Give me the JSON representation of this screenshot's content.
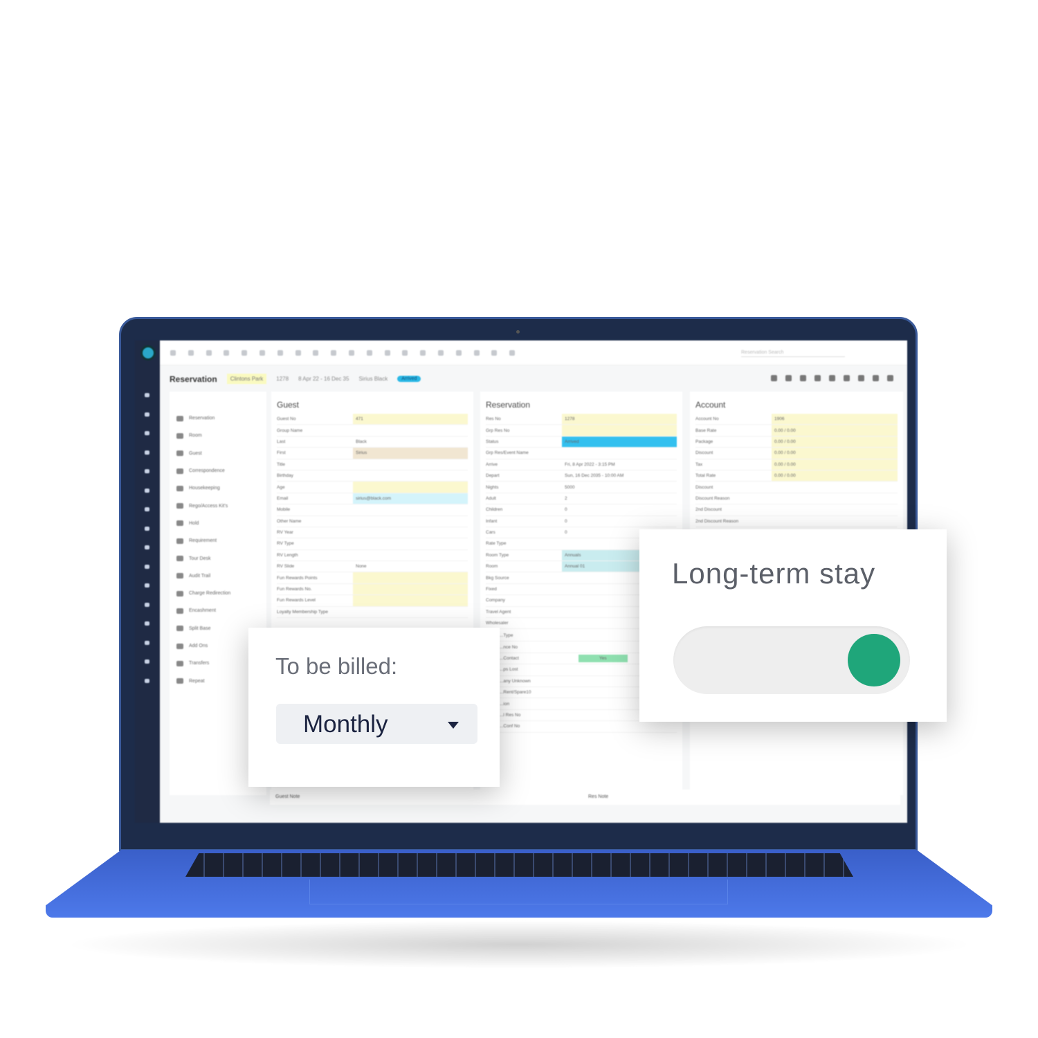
{
  "header": {
    "title": "Reservation",
    "property": "Clintons Park",
    "res_no": "1278",
    "dates": "8 Apr 22 - 16 Dec 35",
    "guest": "Sirius Black",
    "status": "Arrived",
    "search_placeholder": "Reservation Search"
  },
  "menu": [
    "Reservation",
    "Room",
    "Guest",
    "Correspondence",
    "Housekeeping",
    "Rego/Access Kit's",
    "Hold",
    "Requirement",
    "Tour Desk",
    "Audit Trail",
    "Charge Redirection",
    "Encashment",
    "Split Base",
    "Add Ons",
    "Transfers",
    "Repeat"
  ],
  "guest": {
    "title": "Guest",
    "rows": [
      [
        "Guest No",
        "471",
        "#fbf8cf"
      ],
      [
        "Group Name",
        "",
        ""
      ],
      [
        "Last",
        "Black",
        ""
      ],
      [
        "First",
        "Sirius",
        "#f1e6d2"
      ],
      [
        "Title",
        "",
        ""
      ],
      [
        "Birthday",
        "",
        ""
      ],
      [
        "Age",
        "",
        "#fbf8cf"
      ],
      [
        "Email",
        "sirius@black.com",
        "#d4f4fb"
      ],
      [
        "Mobile",
        "",
        ""
      ],
      [
        "Other Name",
        "",
        ""
      ],
      [
        "RV Year",
        "",
        ""
      ],
      [
        "RV Type",
        "",
        ""
      ],
      [
        "RV Length",
        "",
        ""
      ],
      [
        "RV Slide",
        "None",
        ""
      ],
      [
        "Fun Rewards Points",
        "",
        "#fbf8cf"
      ],
      [
        "Fun Rewards No.",
        "",
        "#fbf8cf"
      ],
      [
        "Fun Rewards Level",
        "",
        "#fbf8cf"
      ],
      [
        "Loyalty Membership Type",
        "",
        ""
      ]
    ]
  },
  "reservation": {
    "title": "Reservation",
    "rows": [
      [
        "Res No",
        "1278",
        "#fbf8cf"
      ],
      [
        "Grp Res No",
        "",
        "#fbf8cf"
      ],
      [
        "Status",
        "Arrived",
        "#33c0ef"
      ],
      [
        "Grp Res/Event Name",
        "",
        ""
      ],
      [
        "Arrive",
        "Fri, 8 Apr 2022 - 3:15 PM",
        ""
      ],
      [
        "Depart",
        "Sun, 16 Dec 2035 - 10:00 AM",
        ""
      ],
      [
        "Nights",
        "5000",
        ""
      ],
      [
        "Adult",
        "2",
        ""
      ],
      [
        "Children",
        "0",
        ""
      ],
      [
        "Infant",
        "0",
        ""
      ],
      [
        "Cars",
        "0",
        ""
      ],
      [
        "Rate Type",
        "",
        ""
      ],
      [
        "Room Type",
        "Annuals",
        "#c9ecef"
      ],
      [
        "Room",
        "Annual 01",
        "#c9ecef"
      ],
      [
        "Bkg Source",
        "",
        ""
      ],
      [
        "Fixed",
        "",
        ""
      ],
      [
        "Company",
        "",
        ""
      ],
      [
        "Travel Agent",
        "",
        ""
      ],
      [
        "Wholesaler",
        "",
        ""
      ]
    ],
    "extra": [
      "...Type",
      "...nce No",
      "...Contact",
      "...ps Lost",
      "...any Unknown",
      "...Rent/Spare10",
      "...ion",
      "...l Res No",
      "...Conf No"
    ],
    "flag": "Yes"
  },
  "account": {
    "title": "Account",
    "rows": [
      [
        "Account No",
        "1906",
        "#fbf8cf"
      ],
      [
        "Base Rate",
        "0.00 / 0.00",
        "#fbf8cf"
      ],
      [
        "Package",
        "0.00 / 0.00",
        "#fbf8cf"
      ],
      [
        "Discount",
        "0.00 / 0.00",
        "#fbf8cf"
      ],
      [
        "Tax",
        "0.00 / 0.00",
        "#fbf8cf"
      ],
      [
        "Total Rate",
        "0.00 / 0.00",
        "#fbf8cf"
      ],
      [
        "Discount",
        "",
        ""
      ],
      [
        "Discount Reason",
        "",
        ""
      ],
      [
        "2nd Discount",
        "",
        ""
      ],
      [
        "2nd Discount Reason",
        "",
        ""
      ]
    ]
  },
  "footer": {
    "guest_note": "Guest Note",
    "res_note": "Res Note"
  },
  "billing_card": {
    "label": "To be billed:",
    "value": "Monthly"
  },
  "stay_card": {
    "label": "Long-term stay",
    "toggle_on": true,
    "toggle_color": "#1fa67a"
  }
}
